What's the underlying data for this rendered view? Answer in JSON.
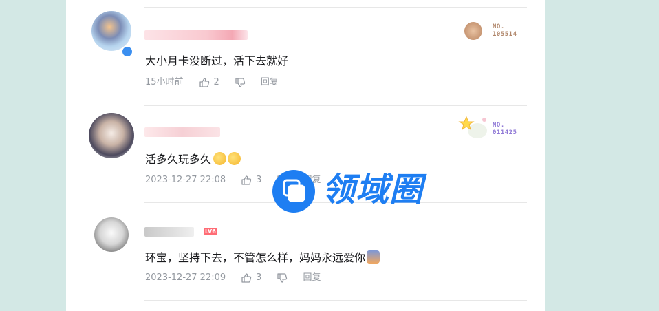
{
  "comments": [
    {
      "text": "大小月卡没断过，活下去就好",
      "time": "15小时前",
      "likes": "2",
      "reply_label": "回复",
      "fan_no_label": "NO.",
      "fan_no": "105514",
      "fan_color": "#b0866a"
    },
    {
      "text": "活多久玩多久",
      "time": "2023-12-27 22:08",
      "likes": "3",
      "reply_label": "回复",
      "fan_no_label": "NO.",
      "fan_no": "011425",
      "fan_color": "#8f78d6"
    },
    {
      "text": "环宝，坚持下去，不管怎么样，妈妈永远爱你",
      "time": "2023-12-27 22:09",
      "likes": "3",
      "reply_label": "回复",
      "level": "LV6"
    }
  ],
  "watermark": {
    "text": "领域圈",
    "color": "#1e7ef2"
  },
  "icons": {
    "like": "thumbs-up-icon",
    "dislike": "thumbs-down-icon",
    "verified": "verified-badge-icon"
  }
}
